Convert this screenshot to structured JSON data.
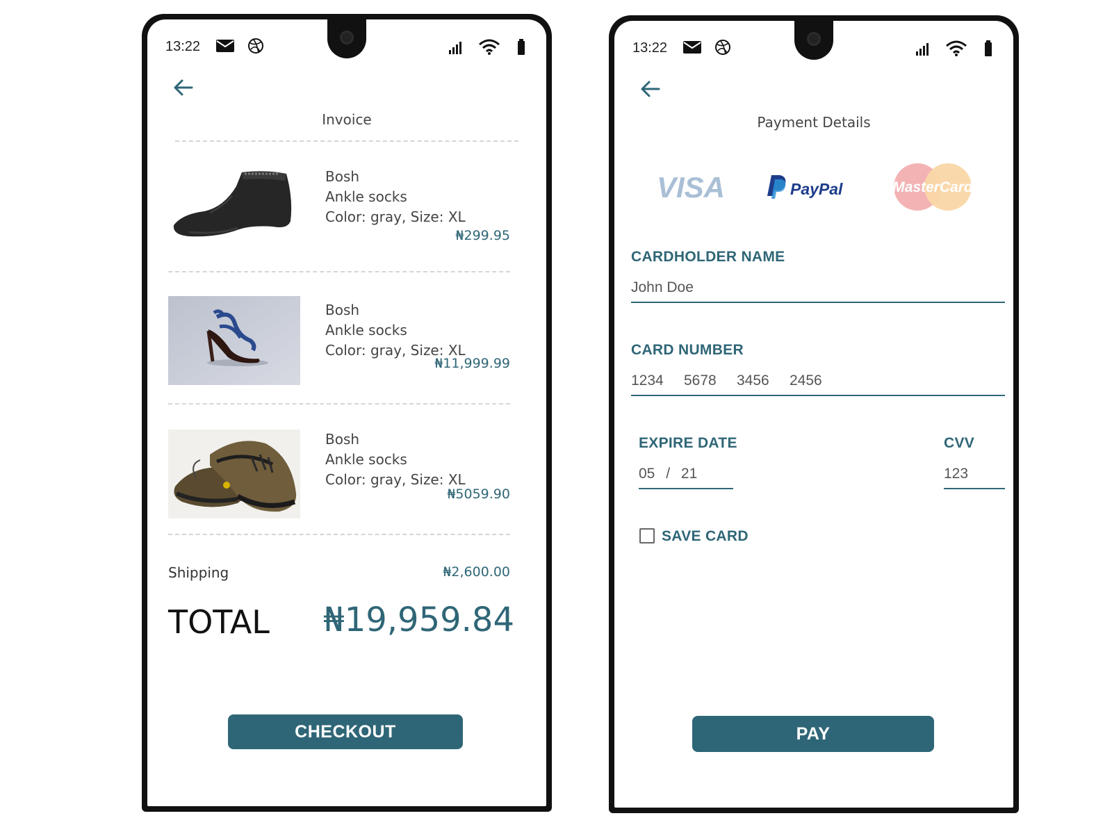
{
  "status_bar": {
    "time": "13:22"
  },
  "invoice": {
    "title": "Invoice",
    "items": [
      {
        "brand": "Bosh",
        "name": "Ankle socks",
        "details": "Color: gray, Size: XL",
        "price": "₦299.95",
        "image": "sock-image"
      },
      {
        "brand": "Bosh",
        "name": "Ankle socks",
        "details": "Color: gray, Size: XL",
        "price": "₦11,999.99",
        "image": "high-heel-image"
      },
      {
        "brand": "Bosh",
        "name": "Ankle socks",
        "details": "Color: gray, Size: XL",
        "price": "₦5059.90",
        "image": "sneakers-image"
      }
    ],
    "shipping_label": "Shipping",
    "shipping_value": "₦2,600.00",
    "total_label": "TOTAL",
    "total_value": "₦19,959.84",
    "checkout_label": "CHECKOUT"
  },
  "payment": {
    "title": "Payment Details",
    "methods": [
      {
        "name": "VISA"
      },
      {
        "name": "PayPal"
      },
      {
        "name": "MasterCard"
      }
    ],
    "cardholder_label": "CARDHOLDER NAME",
    "cardholder_value": "John Doe",
    "card_number_label": "CARD NUMBER",
    "card_number_groups": [
      "1234",
      "5678",
      "3456",
      "2456"
    ],
    "expire_label": "EXPIRE DATE",
    "expire_month": "05",
    "expire_sep": "/",
    "expire_year": "21",
    "cvv_label": "CVV",
    "cvv_value": "123",
    "save_card_label": "SAVE CARD",
    "save_card_checked": false,
    "pay_label": "PAY"
  },
  "colors": {
    "accent": "#2f6677",
    "phone_frame": "#111111",
    "divider": "#d5d5d5"
  }
}
